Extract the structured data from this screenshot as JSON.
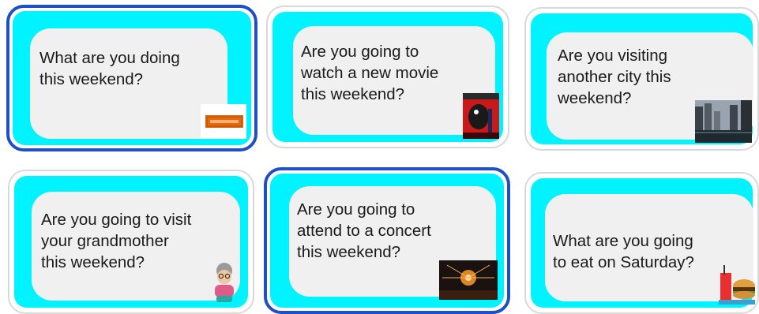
{
  "cards": [
    {
      "question": "What are you doing\nthis weekend?",
      "selected": true,
      "picture": "ticket-icon"
    },
    {
      "question": "Are you going to\nwatch a new movie\nthis weekend?",
      "selected": false,
      "picture": "movie-poster-icon"
    },
    {
      "question": "Are you visiting\nanother city this\nweekend?",
      "selected": false,
      "picture": "city-photo-icon"
    },
    {
      "question": "Are you going to visit\nyour grandmother\nthis weekend?",
      "selected": false,
      "picture": "grandmother-icon"
    },
    {
      "question": "Are you going to\nattend to a concert\nthis weekend?",
      "selected": true,
      "picture": "concert-photo-icon"
    },
    {
      "question": "What are you going\nto eat on Saturday?",
      "selected": false,
      "picture": "fast-food-icon"
    }
  ],
  "colors": {
    "card_fill": "#00f3ff",
    "bubble": "#f0f0f0",
    "selected_border": "#1f4fc4",
    "card_border": "#d9d9d9"
  }
}
